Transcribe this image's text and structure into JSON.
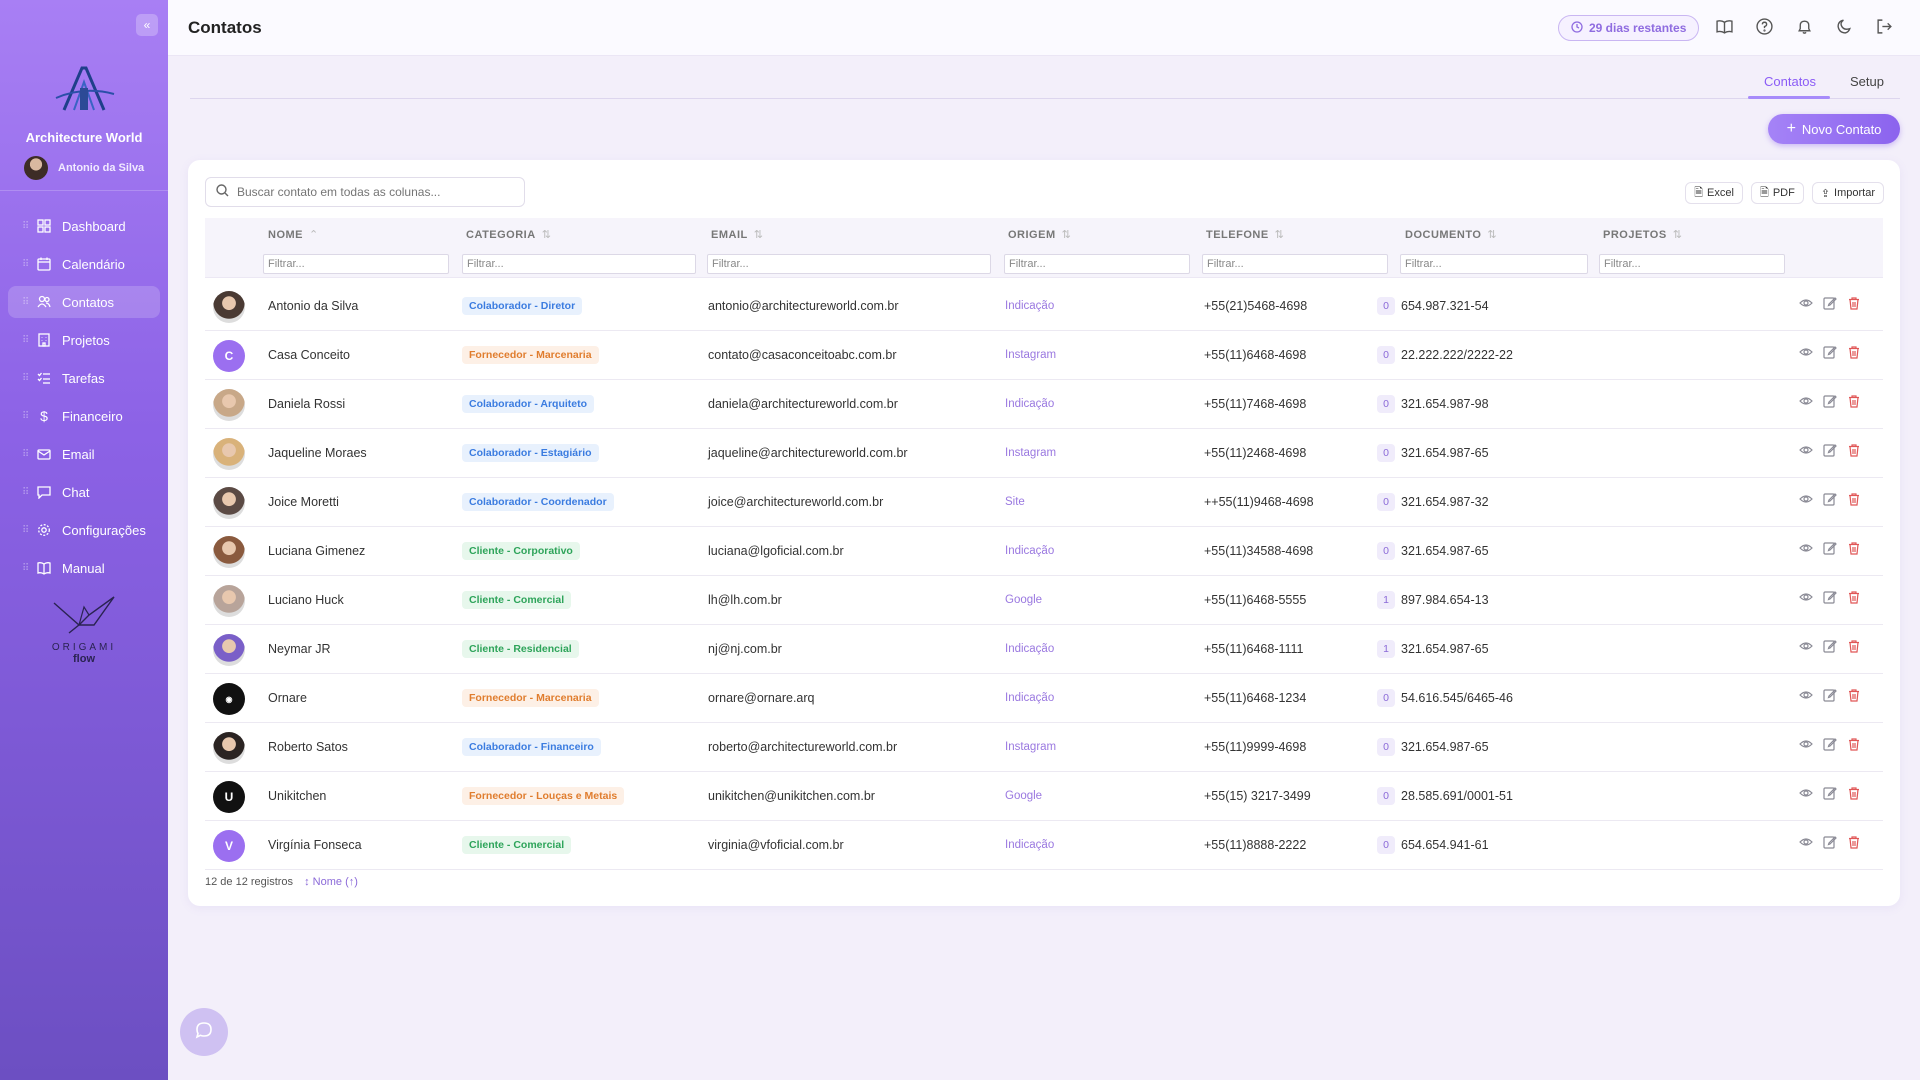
{
  "sidebar": {
    "collapse_icon": "double-chevron-left-icon",
    "brand": "Architecture World",
    "user_name": "Antonio da Silva",
    "items": [
      {
        "label": "Dashboard",
        "icon": "grid-icon"
      },
      {
        "label": "Calendário",
        "icon": "calendar-icon"
      },
      {
        "label": "Contatos",
        "icon": "users-icon",
        "active": true
      },
      {
        "label": "Projetos",
        "icon": "building-icon"
      },
      {
        "label": "Tarefas",
        "icon": "list-check-icon"
      },
      {
        "label": "Financeiro",
        "icon": "dollar-icon"
      },
      {
        "label": "Email",
        "icon": "mail-icon"
      },
      {
        "label": "Chat",
        "icon": "chat-icon"
      },
      {
        "label": "Configurações",
        "icon": "gear-icon"
      },
      {
        "label": "Manual",
        "icon": "book-icon"
      }
    ],
    "footer_logo_line1": "ORIGAMI",
    "footer_logo_line2": "flow"
  },
  "header": {
    "title": "Contatos",
    "trial_label": "29 dias restantes"
  },
  "tabs": [
    {
      "label": "Contatos",
      "active": true
    },
    {
      "label": "Setup",
      "active": false
    }
  ],
  "new_button": "Novo Contato",
  "table": {
    "search_placeholder": "Buscar contato em todas as colunas...",
    "toolbar": {
      "excel": "Excel",
      "pdf": "PDF",
      "import": "Importar"
    },
    "columns": [
      "NOME",
      "CATEGORIA",
      "EMAIL",
      "ORIGEM",
      "TELEFONE",
      "DOCUMENTO",
      "PROJETOS"
    ],
    "filter_placeholder": "Filtrar...",
    "rows": [
      {
        "nome": "Antonio da Silva",
        "categoria": "Colaborador - Diretor",
        "cat_type": "colab",
        "email": "antonio@architectureworld.com.br",
        "origem": "Indicação",
        "telefone": "+55(21)5468-4698",
        "documento": "654.987.321-54",
        "projetos": "0",
        "avatar": "photo",
        "avatar_color": "#4a3a33"
      },
      {
        "nome": "Casa Conceito",
        "categoria": "Fornecedor - Marcenaria",
        "cat_type": "forn",
        "email": "contato@casaconceitoabc.com.br",
        "origem": "Instagram",
        "telefone": "+55(11)6468-4698",
        "documento": "22.222.222/2222-22",
        "projetos": "0",
        "avatar": "C",
        "avatar_color": "#9b6ff0"
      },
      {
        "nome": "Daniela Rossi",
        "categoria": "Colaborador - Arquiteto",
        "cat_type": "colab",
        "email": "daniela@architectureworld.com.br",
        "origem": "Indicação",
        "telefone": "+55(11)7468-4698",
        "documento": "321.654.987-98",
        "projetos": "0",
        "avatar": "photo",
        "avatar_color": "#c8a888"
      },
      {
        "nome": "Jaqueline Moraes",
        "categoria": "Colaborador - Estagiário",
        "cat_type": "colab",
        "email": "jaqueline@architectureworld.com.br",
        "origem": "Instagram",
        "telefone": "+55(11)2468-4698",
        "documento": "321.654.987-65",
        "projetos": "0",
        "avatar": "photo",
        "avatar_color": "#d9b27a"
      },
      {
        "nome": "Joice Moretti",
        "categoria": "Colaborador - Coordenador",
        "cat_type": "colab",
        "email": "joice@architectureworld.com.br",
        "origem": "Site",
        "telefone": "++55(11)9468-4698",
        "documento": "321.654.987-32",
        "projetos": "0",
        "avatar": "photo",
        "avatar_color": "#5b4a44"
      },
      {
        "nome": "Luciana Gimenez",
        "categoria": "Cliente - Corporativo",
        "cat_type": "cli",
        "email": "luciana@lgoficial.com.br",
        "origem": "Indicação",
        "telefone": "+55(11)34588-4698",
        "documento": "321.654.987-65",
        "projetos": "0",
        "avatar": "photo",
        "avatar_color": "#8a5a3e"
      },
      {
        "nome": "Luciano Huck",
        "categoria": "Cliente - Comercial",
        "cat_type": "cli",
        "email": "lh@lh.com.br",
        "origem": "Google",
        "telefone": "+55(11)6468-5555",
        "documento": "897.984.654-13",
        "projetos": "1",
        "avatar": "photo",
        "avatar_color": "#b8a49a"
      },
      {
        "nome": "Neymar JR",
        "categoria": "Cliente - Residencial",
        "cat_type": "cli",
        "email": "nj@nj.com.br",
        "origem": "Indicação",
        "telefone": "+55(11)6468-1111",
        "documento": "321.654.987-65",
        "projetos": "1",
        "avatar": "photo",
        "avatar_color": "#7a5fc8"
      },
      {
        "nome": "Ornare",
        "categoria": "Fornecedor - Marcenaria",
        "cat_type": "forn",
        "email": "ornare@ornare.arq",
        "origem": "Indicação",
        "telefone": "+55(11)6468-1234",
        "documento": "54.616.545/6465-46",
        "projetos": "0",
        "avatar": "logo",
        "avatar_color": "#111111"
      },
      {
        "nome": "Roberto Satos",
        "categoria": "Colaborador - Financeiro",
        "cat_type": "colab",
        "email": "roberto@architectureworld.com.br",
        "origem": "Instagram",
        "telefone": "+55(11)9999-4698",
        "documento": "321.654.987-65",
        "projetos": "0",
        "avatar": "photo",
        "avatar_color": "#2b2422"
      },
      {
        "nome": "Unikitchen",
        "categoria": "Fornecedor - Louças e Metais",
        "cat_type": "forn",
        "email": "unikitchen@unikitchen.com.br",
        "origem": "Google",
        "telefone": "+55(15) 3217-3499",
        "documento": "28.585.691/0001-51",
        "projetos": "0",
        "avatar": "U",
        "avatar_color": "#111111"
      },
      {
        "nome": "Virgínia Fonseca",
        "categoria": "Cliente - Comercial",
        "cat_type": "cli",
        "email": "virginia@vfoficial.com.br",
        "origem": "Indicação",
        "telefone": "+55(11)8888-2222",
        "documento": "654.654.941-61",
        "projetos": "0",
        "avatar": "V",
        "avatar_color": "#9b6ff0"
      }
    ],
    "footer_count": "12 de 12 registros",
    "footer_sort": "↕ Nome (↑)"
  },
  "colors": {
    "accent": "#8b5cf6",
    "sidebar_top": "#a87ff4",
    "sidebar_bottom": "#6c4fc2"
  }
}
